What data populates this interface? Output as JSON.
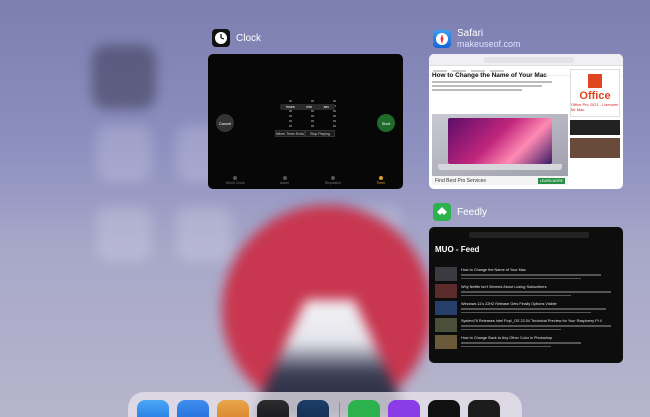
{
  "apps": {
    "clock": {
      "title": "Clock",
      "icon": "clock-icon",
      "timer": {
        "left_button": "Cancel",
        "right_button": "Start",
        "units": [
          "hours",
          "min",
          "sec"
        ],
        "options": [
          "When Timer Ends",
          "Stop Playing"
        ],
        "tabs": [
          "World Clock",
          "Alarm",
          "Stopwatch",
          "Timer"
        ]
      }
    },
    "safari": {
      "title": "Safari",
      "subtitle": "makeuseof.com",
      "icon": "safari-icon",
      "page": {
        "headline": "How to Change the Name of Your Mac",
        "ad_brand": "Office",
        "ad_sub": "Office Pro 2021 - Lizenzen für Mac",
        "banner": "Find Best Pro Services",
        "banner_button": "LEARN MORE"
      }
    },
    "feedly": {
      "title": "Feedly",
      "icon": "feedly-icon",
      "feed_title": "MUO - Feed",
      "items": [
        "How to Change the Name of Your Mac",
        "Why Netflix Isn't Worried About Losing Subscribers",
        "Windows 11's 22H2 Release Gets Finally Options Visible",
        "System76 Releases Intel Pop!_OS 22.04 Technical Preview for Your Raspberry Pi 4",
        "How to Change Back to Any Other Color in Photoshop"
      ]
    }
  },
  "dock": {
    "icons": [
      "safari-icon",
      "files-icon",
      "books-icon",
      "notes-icon",
      "photos-icon",
      "feedly-icon",
      "twitch-icon",
      "clock-icon",
      "feedly-small-icon"
    ]
  }
}
